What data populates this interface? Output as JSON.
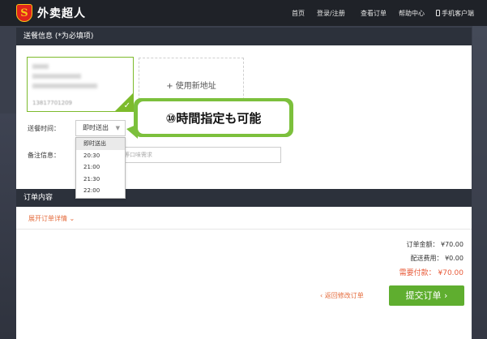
{
  "header": {
    "logo_mark": "S",
    "logo_text": "外卖超人",
    "nav": [
      "首页",
      "登录/注册",
      "查看订单",
      "帮助中心",
      "手机客户端"
    ]
  },
  "delivery": {
    "section_title": "送餐信息 (*为必填项)",
    "address_phone": "13817701209",
    "new_address_label": "+ 使用新地址",
    "time_label": "送餐时间：",
    "time_selected": "即时送出",
    "time_options": [
      "即时送出",
      "20:30",
      "21:00",
      "21:30",
      "22:00"
    ],
    "remark_label": "备注信息：",
    "remark_placeholder": "辣等口味需求"
  },
  "order": {
    "section_title": "订单内容",
    "expand_label": "展开订单详情",
    "amount": "订单金额： ¥70.00",
    "delivery_fee": "配送费用： ¥0.00",
    "total": "需要付款： ¥70.00",
    "back_label": "返回修改订单",
    "submit_label": "提交订单"
  },
  "annotation": {
    "text": "⑩時間指定も可能"
  },
  "colors": {
    "accent_green": "#5fae2f",
    "callout_green": "#7cc03c",
    "link_orange": "#e46a3a",
    "header_dark": "#2c313b"
  }
}
